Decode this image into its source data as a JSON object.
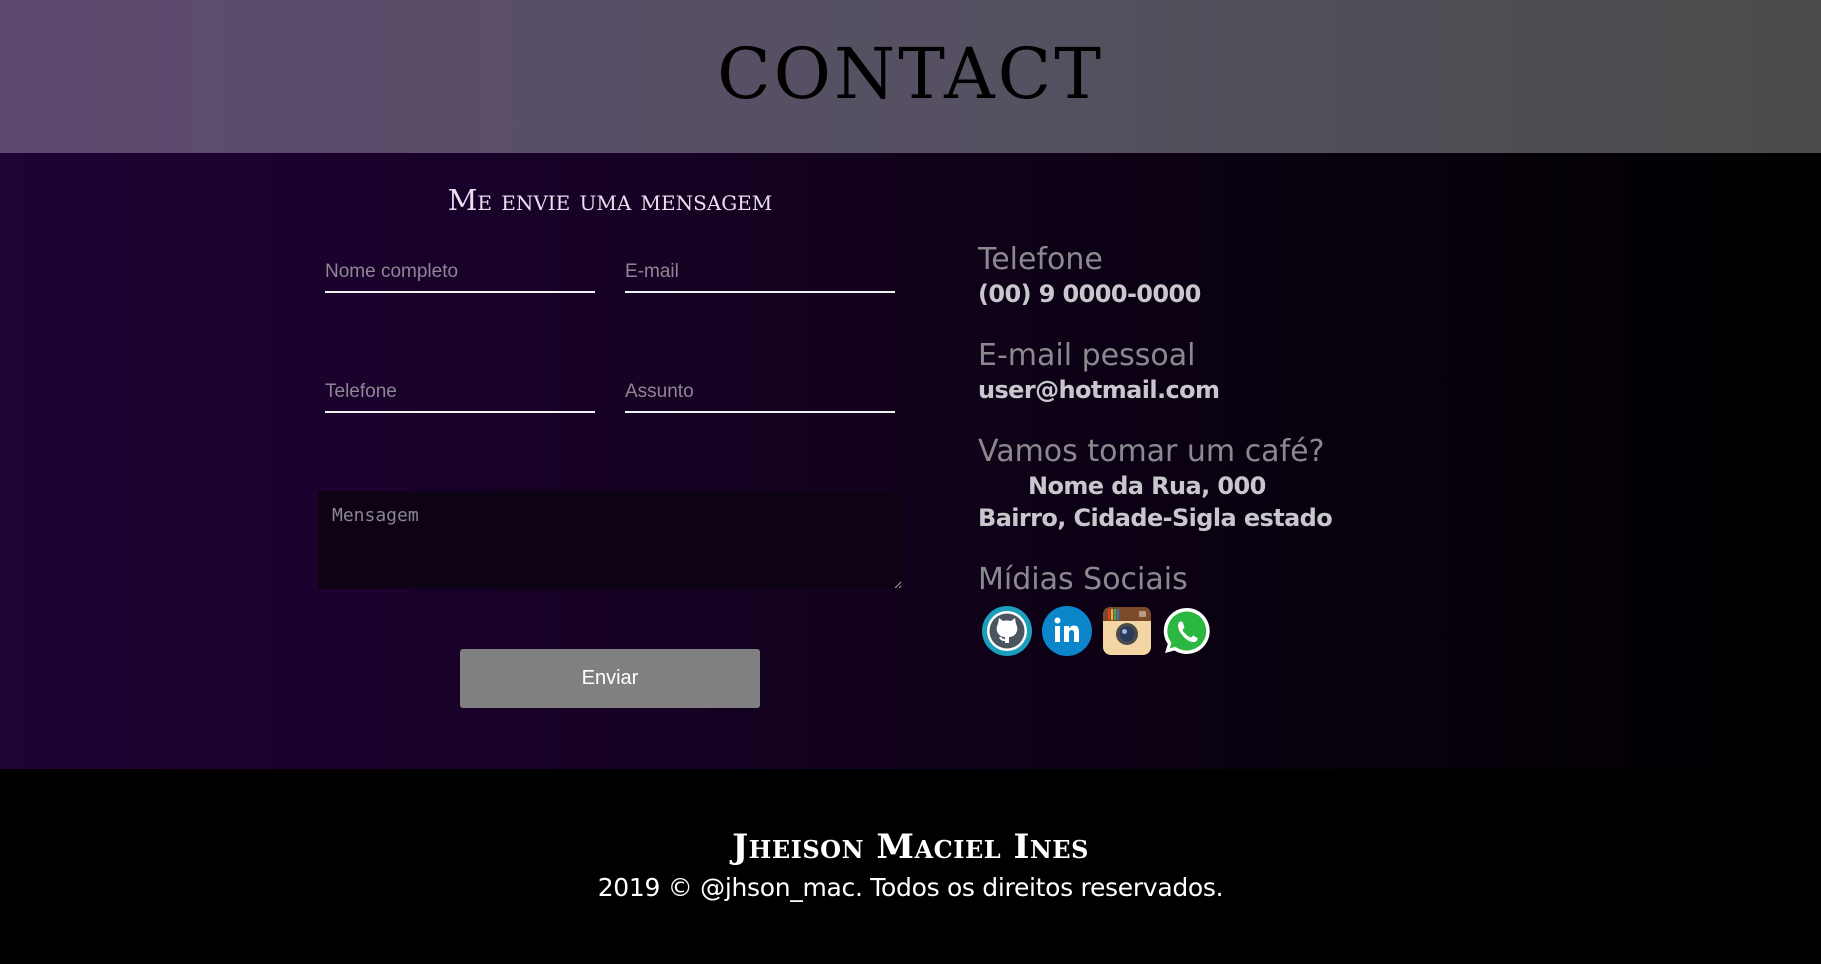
{
  "header": {
    "title": "CONTACT"
  },
  "form": {
    "title": "Me envie uma mensagem",
    "name_placeholder": "Nome completo",
    "email_placeholder": "E-mail",
    "phone_placeholder": "Telefone",
    "subject_placeholder": "Assunto",
    "message_placeholder": "Mensagem",
    "send_label": "Enviar"
  },
  "info": {
    "phone_label": "Telefone",
    "phone_value": "(00) 9 0000-0000",
    "email_label": "E-mail pessoal",
    "email_value": "user@hotmail.com",
    "address_label": "Vamos tomar um café?",
    "address_line1": "Nome da Rua, 000",
    "address_line2": "Bairro, Cidade-Sigla estado",
    "social_label": "Mídias Sociais",
    "social_icons": [
      "github-icon",
      "linkedin-icon",
      "instagram-icon",
      "whatsapp-icon"
    ]
  },
  "footer": {
    "name": "Jheison Maciel Ines",
    "copyright": "2019 © @jhson_mac. Todos os direitos reservados."
  },
  "colors": {
    "header_gradient_start": "#5e4a70",
    "header_gradient_end": "#4b4b4b",
    "main_gradient_start": "#1f0236",
    "main_gradient_end": "#000000",
    "send_button": "#808080",
    "github": "#1b9fbd",
    "linkedin": "#0b86ca",
    "whatsapp": "#2cb742"
  }
}
